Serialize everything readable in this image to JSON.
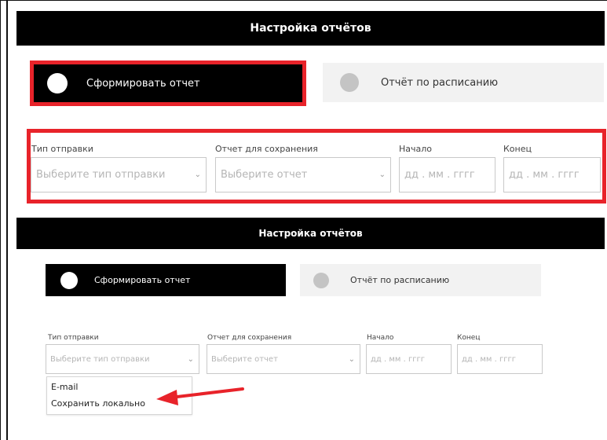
{
  "top_panel": {
    "title": "Настройка отчётов",
    "mode_manual": "Сформировать отчет",
    "mode_schedule": "Отчёт по расписанию",
    "send_type": {
      "label": "Тип отправки",
      "placeholder": "Выберите тип отправки"
    },
    "report": {
      "label": "Отчет для сохранения",
      "placeholder": "Выберите отчет"
    },
    "start": {
      "label": "Начало",
      "placeholder": "дд . мм . гггг"
    },
    "end": {
      "label": "Конец",
      "placeholder": "дд . мм . гггг"
    }
  },
  "bottom_panel": {
    "title": "Настройка отчётов",
    "mode_manual": "Сформировать отчет",
    "mode_schedule": "Отчёт по расписанию",
    "send_type": {
      "label": "Тип отправки",
      "placeholder": "Выберите тип отправки"
    },
    "report": {
      "label": "Отчет для сохранения",
      "placeholder": "Выберите отчет"
    },
    "start": {
      "label": "Начало",
      "placeholder": "дд . мм . гггг"
    },
    "end": {
      "label": "Конец",
      "placeholder": "дд . мм . гггг"
    },
    "dropdown_options": [
      "E-mail",
      "Сохранить локально"
    ]
  },
  "colors": {
    "header_bg": "#000000",
    "highlight": "#e8232a",
    "active_mode_bg": "#000000",
    "inactive_mode_bg": "#f2f2f2",
    "inactive_dot": "#c4c4c4"
  },
  "icons": {
    "select_chevron": "chevron-down-icon",
    "annotation_arrow": "arrow-left-icon"
  }
}
